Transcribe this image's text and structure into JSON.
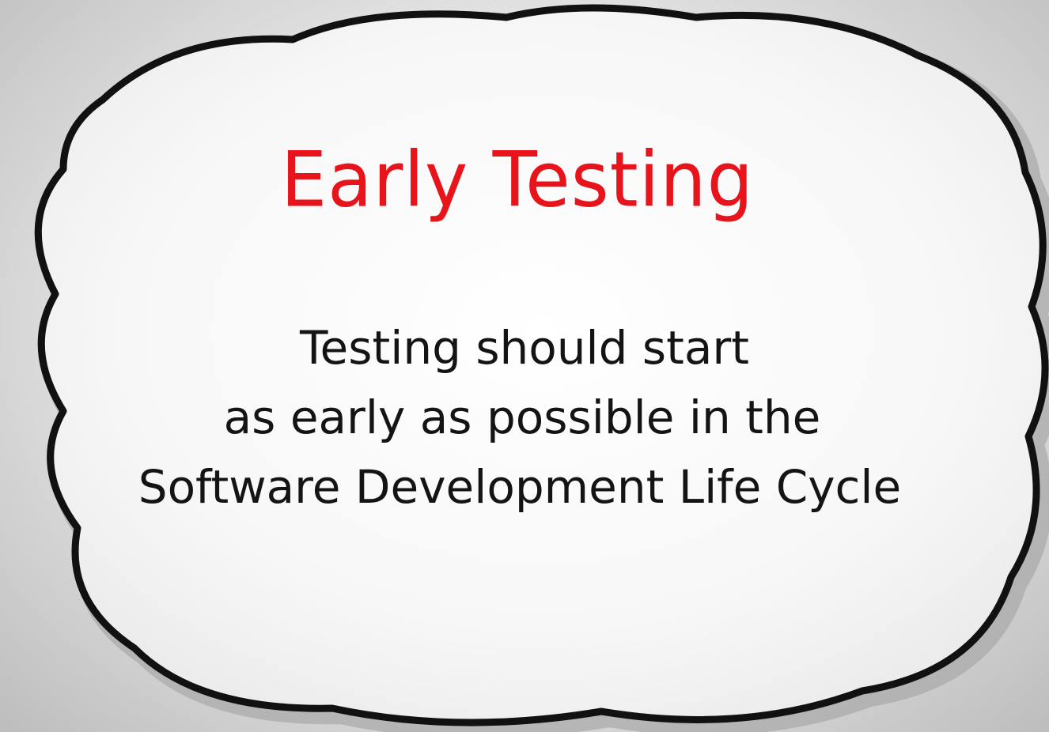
{
  "slide": {
    "title": "Early Testing",
    "lines": [
      "Testing should start",
      "as early as possible in the",
      "Software Development Life Cycle"
    ]
  },
  "colors": {
    "title": "#e8141c",
    "text": "#141414",
    "cloud_fill": "#fbfbfb",
    "cloud_outline": "#111111",
    "cloud_shadow": "#9a9a9a",
    "background": "#d9d9d9"
  },
  "icons": {
    "cloud": "thought-cloud-shape"
  }
}
